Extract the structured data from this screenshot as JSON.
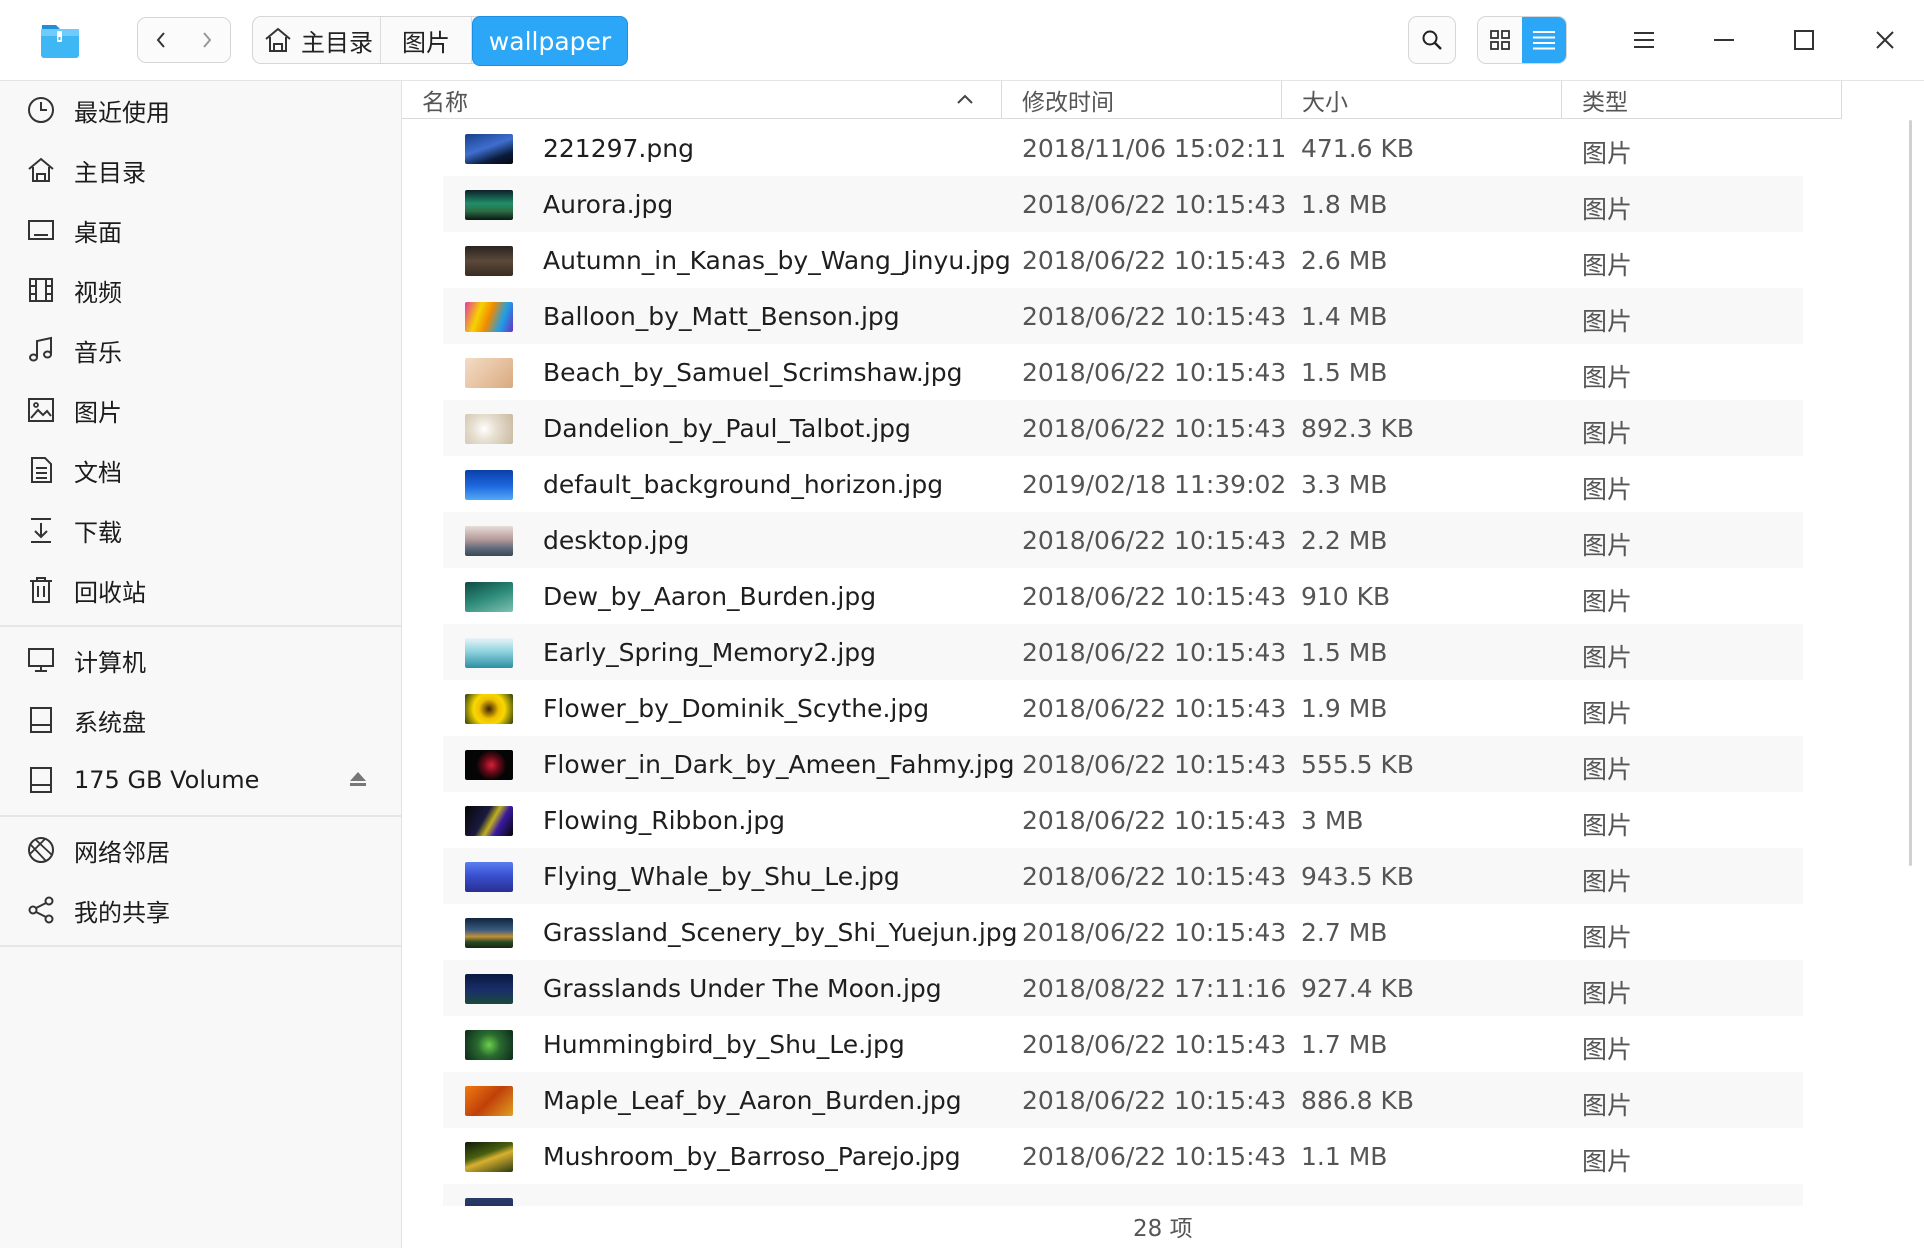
{
  "toolbar": {
    "breadcrumb": [
      "主目录",
      "图片",
      "wallpaper"
    ]
  },
  "sidebar": {
    "group1": [
      "最近使用",
      "主目录",
      "桌面",
      "视频",
      "音乐",
      "图片",
      "文档",
      "下载",
      "回收站"
    ],
    "group2": [
      "计算机",
      "系统盘",
      "175 GB Volume"
    ],
    "group3": [
      "网络邻居",
      "我的共享"
    ]
  },
  "columns": {
    "name": "名称",
    "modified": "修改时间",
    "size": "大小",
    "type": "类型"
  },
  "files": [
    {
      "name": "221297.png",
      "modified": "2018/11/06 15:02:11",
      "size": "471.6 KB",
      "type": "图片"
    },
    {
      "name": "Aurora.jpg",
      "modified": "2018/06/22 10:15:43",
      "size": "1.8 MB",
      "type": "图片"
    },
    {
      "name": "Autumn_in_Kanas_by_Wang_Jinyu.jpg",
      "modified": "2018/06/22 10:15:43",
      "size": "2.6 MB",
      "type": "图片"
    },
    {
      "name": "Balloon_by_Matt_Benson.jpg",
      "modified": "2018/06/22 10:15:43",
      "size": "1.4 MB",
      "type": "图片"
    },
    {
      "name": "Beach_by_Samuel_Scrimshaw.jpg",
      "modified": "2018/06/22 10:15:43",
      "size": "1.5 MB",
      "type": "图片"
    },
    {
      "name": "Dandelion_by_Paul_Talbot.jpg",
      "modified": "2018/06/22 10:15:43",
      "size": "892.3 KB",
      "type": "图片"
    },
    {
      "name": "default_background_horizon.jpg",
      "modified": "2019/02/18 11:39:02",
      "size": "3.3 MB",
      "type": "图片"
    },
    {
      "name": "desktop.jpg",
      "modified": "2018/06/22 10:15:43",
      "size": "2.2 MB",
      "type": "图片"
    },
    {
      "name": "Dew_by_Aaron_Burden.jpg",
      "modified": "2018/06/22 10:15:43",
      "size": "910 KB",
      "type": "图片"
    },
    {
      "name": "Early_Spring_Memory2.jpg",
      "modified": "2018/06/22 10:15:43",
      "size": "1.5 MB",
      "type": "图片"
    },
    {
      "name": "Flower_by_Dominik_Scythe.jpg",
      "modified": "2018/06/22 10:15:43",
      "size": "1.9 MB",
      "type": "图片"
    },
    {
      "name": "Flower_in_Dark_by_Ameen_Fahmy.jpg",
      "modified": "2018/06/22 10:15:43",
      "size": "555.5 KB",
      "type": "图片"
    },
    {
      "name": "Flowing_Ribbon.jpg",
      "modified": "2018/06/22 10:15:43",
      "size": "3 MB",
      "type": "图片"
    },
    {
      "name": "Flying_Whale_by_Shu_Le.jpg",
      "modified": "2018/06/22 10:15:43",
      "size": "943.5 KB",
      "type": "图片"
    },
    {
      "name": "Grassland_Scenery_by_Shi_Yuejun.jpg",
      "modified": "2018/06/22 10:15:43",
      "size": "2.7 MB",
      "type": "图片"
    },
    {
      "name": "Grasslands Under The Moon.jpg",
      "modified": "2018/08/22 17:11:16",
      "size": "927.4 KB",
      "type": "图片"
    },
    {
      "name": "Hummingbird_by_Shu_Le.jpg",
      "modified": "2018/06/22 10:15:43",
      "size": "1.7 MB",
      "type": "图片"
    },
    {
      "name": "Maple_Leaf_by_Aaron_Burden.jpg",
      "modified": "2018/06/22 10:15:43",
      "size": "886.8 KB",
      "type": "图片"
    },
    {
      "name": "Mushroom_by_Barroso_Parejo.jpg",
      "modified": "2018/06/22 10:15:43",
      "size": "1.1 MB",
      "type": "图片"
    }
  ],
  "status": "28 项"
}
